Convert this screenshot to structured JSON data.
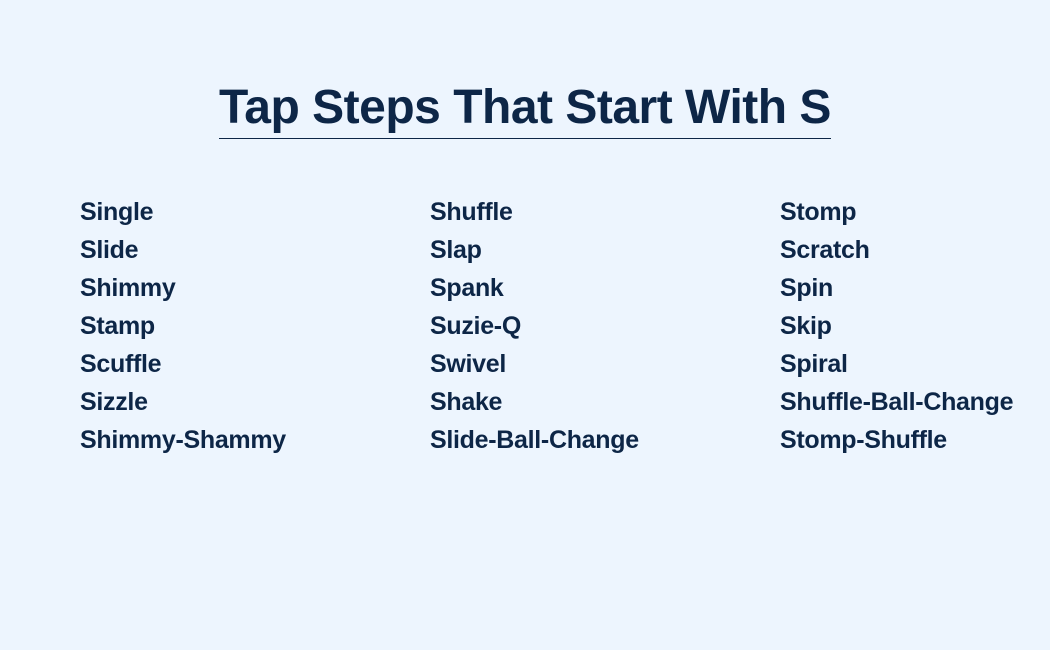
{
  "title": "Tap Steps That Start With S",
  "colors": {
    "background": "#edf5fe",
    "text": "#0d2647"
  },
  "columns": [
    {
      "items": [
        "Single",
        "Slide",
        "Shimmy",
        "Stamp",
        "Scuffle",
        "Sizzle",
        "Shimmy-Shammy"
      ]
    },
    {
      "items": [
        "Shuffle",
        "Slap",
        "Spank",
        "Suzie-Q",
        "Swivel",
        "Shake",
        "Slide-Ball-Change"
      ]
    },
    {
      "items": [
        "Stomp",
        "Scratch",
        "Spin",
        "Skip",
        "Spiral",
        "Shuffle-Ball-Change",
        "Stomp-Shuffle"
      ]
    }
  ]
}
